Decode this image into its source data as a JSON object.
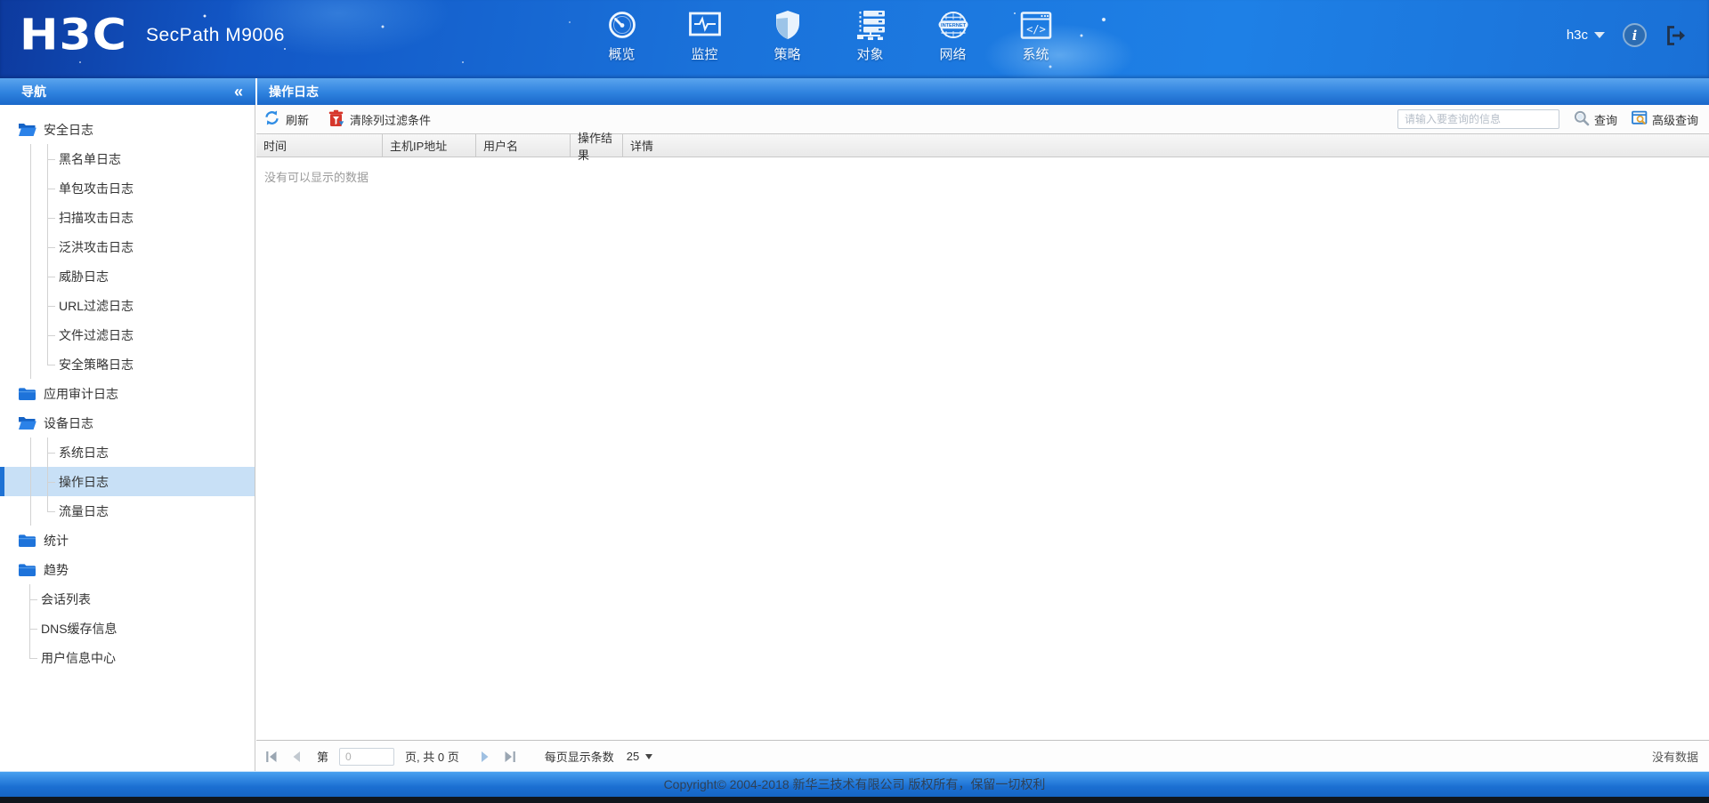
{
  "app": {
    "logo": "H3C",
    "product": "SecPath M9006"
  },
  "top_nav": {
    "items": [
      {
        "label": "概览",
        "icon": "gauge-icon"
      },
      {
        "label": "监控",
        "icon": "monitor-icon"
      },
      {
        "label": "策略",
        "icon": "shield-icon"
      },
      {
        "label": "对象",
        "icon": "objects-icon"
      },
      {
        "label": "网络",
        "icon": "network-globe-icon"
      },
      {
        "label": "系统",
        "icon": "system-code-icon"
      }
    ]
  },
  "user_menu": {
    "username": "h3c"
  },
  "sidebar": {
    "title": "导航",
    "collapse_glyph": "«",
    "tree": [
      {
        "label": "安全日志",
        "type": "folder",
        "state": "open"
      },
      {
        "label": "黑名单日志",
        "type": "child-leaf"
      },
      {
        "label": "单包攻击日志",
        "type": "child-leaf"
      },
      {
        "label": "扫描攻击日志",
        "type": "child-leaf"
      },
      {
        "label": "泛洪攻击日志",
        "type": "child-leaf"
      },
      {
        "label": "威胁日志",
        "type": "child-leaf"
      },
      {
        "label": "URL过滤日志",
        "type": "child-leaf"
      },
      {
        "label": "文件过滤日志",
        "type": "child-leaf"
      },
      {
        "label": "安全策略日志",
        "type": "child-leaf",
        "last": true
      },
      {
        "label": "应用审计日志",
        "type": "folder",
        "state": "closed"
      },
      {
        "label": "设备日志",
        "type": "folder",
        "state": "open"
      },
      {
        "label": "系统日志",
        "type": "child-leaf"
      },
      {
        "label": "操作日志",
        "type": "child-leaf",
        "selected": true
      },
      {
        "label": "流量日志",
        "type": "child-leaf",
        "last": true
      },
      {
        "label": "统计",
        "type": "folder",
        "state": "closed"
      },
      {
        "label": "趋势",
        "type": "folder",
        "state": "closed"
      },
      {
        "label": "会话列表",
        "type": "root-leaf"
      },
      {
        "label": "DNS缓存信息",
        "type": "root-leaf"
      },
      {
        "label": "用户信息中心",
        "type": "root-leaf",
        "last": true
      }
    ]
  },
  "main": {
    "title": "操作日志",
    "toolbar": {
      "refresh_label": "刷新",
      "clear_filter_label": "清除列过滤条件",
      "search_placeholder": "请输入要查询的信息",
      "search_value": "",
      "query_label": "查询",
      "advanced_query_label": "高级查询"
    },
    "table": {
      "columns": [
        "时间",
        "主机IP地址",
        "用户名",
        "操作结果",
        "详情"
      ],
      "rows": []
    },
    "empty_text": "没有可以显示的数据",
    "pagination": {
      "page_label_prefix": "第",
      "page_input_value": "0",
      "page_label_suffix": "页, 共 0 页",
      "per_page_label": "每页显示条数",
      "per_page_value": "25",
      "right_status": "没有数据"
    }
  },
  "footer": {
    "copyright": "Copyright© 2004-2018 新华三技术有限公司 版权所有，保留一切权利"
  },
  "colors": {
    "banner_blue": "#1a72da",
    "bar_gradient_top": "#5aa4ee",
    "bar_gradient_bottom": "#1a68ca",
    "selected_item_bg": "#c8e0f6",
    "selected_item_bar": "#1f72d4",
    "accent_red": "#d6372c",
    "footer_strip": "#10161c"
  }
}
